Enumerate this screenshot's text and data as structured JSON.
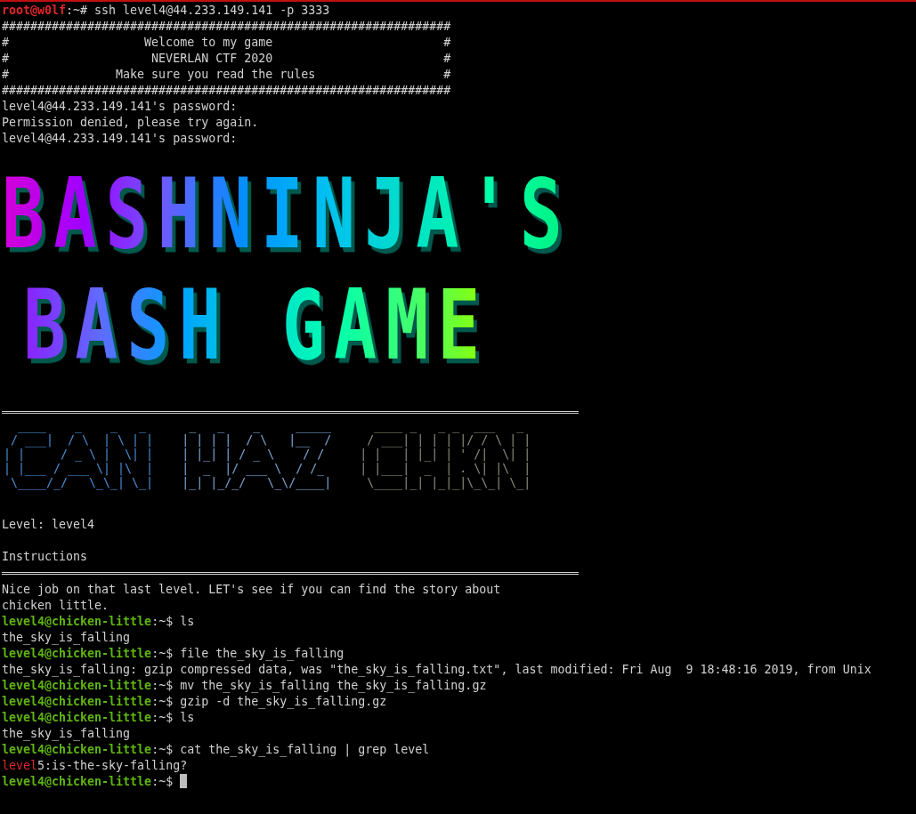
{
  "header_lines": [
    {
      "kind": "prompt",
      "color": "#e3262a",
      "user_host": "root@w0lf",
      "path": ":~#",
      "command": "ssh level4@44.233.149.141 -p 3333",
      "cursor": false
    },
    {
      "kind": "output",
      "text": "###############################################################"
    },
    {
      "kind": "output",
      "text": "#                   Welcome to my game                        #"
    },
    {
      "kind": "output",
      "text": "#                    NEVERLAN CTF 2020                        #"
    },
    {
      "kind": "output",
      "text": "#               Make sure you read the rules                  #"
    },
    {
      "kind": "output",
      "text": "###############################################################"
    },
    {
      "kind": "output",
      "text": "level4@44.233.149.141's password:"
    },
    {
      "kind": "output",
      "text": "Permission denied, please try again."
    },
    {
      "kind": "output",
      "text": "level4@44.233.149.141's password:"
    }
  ],
  "banner": {
    "lines": [
      "BASHNINJA'S",
      "BASH GAME"
    ]
  },
  "ascii_art": {
    "words": [
      {
        "color": "#4a8fd6",
        "lines": [
          "  ____    _    _   _ ",
          " / ___|  / \\  | \\ | |",
          "| |     / _ \\ |  \\| |",
          "| |___ / ___ \\| |\\  |",
          " \\____/_/   \\_\\_| \\_|"
        ]
      },
      {
        "color": "#7ea6d6",
        "lines": [
          " _   _    _     _____",
          "| | | |  / \\   |__  /",
          "| |_| | / _ \\    / / ",
          "|  _  |/ ___ \\  / /_ ",
          "|_| |_/_/   \\_\\/____|"
        ]
      },
      {
        "color": "#8c8c7a",
        "lines": [
          "  ____ _   _ _  ___   _ ",
          " / ___| | | | |/ / \\ | |",
          "| |   | |_| | ' /|  \\| |",
          "| |___|  _  | . \\| |\\  |",
          " \\____|_| |_|_|\\_\\_| \\_|"
        ]
      }
    ]
  },
  "info_lines": [
    "Level: level4",
    "Instructions"
  ],
  "session_lines": [
    {
      "kind": "output",
      "text": "Nice job on that last level. LET's see if you can find the story about"
    },
    {
      "kind": "output",
      "text": "chicken little."
    },
    {
      "kind": "prompt",
      "color": "#5fb40f",
      "user_host": "level4@chicken-little",
      "path": ":~$",
      "command": "ls",
      "cursor": false
    },
    {
      "kind": "output",
      "text": "the_sky_is_falling"
    },
    {
      "kind": "prompt",
      "color": "#5fb40f",
      "user_host": "level4@chicken-little",
      "path": ":~$",
      "command": "file the_sky_is_falling",
      "cursor": false
    },
    {
      "kind": "output",
      "text": "the_sky_is_falling: gzip compressed data, was \"the_sky_is_falling.txt\", last modified: Fri Aug  9 18:48:16 2019, from Unix"
    },
    {
      "kind": "prompt",
      "color": "#5fb40f",
      "user_host": "level4@chicken-little",
      "path": ":~$",
      "command": "mv the_sky_is_falling the_sky_is_falling.gz",
      "cursor": false
    },
    {
      "kind": "prompt",
      "color": "#5fb40f",
      "user_host": "level4@chicken-little",
      "path": ":~$",
      "command": "gzip -d the_sky_is_falling.gz",
      "cursor": false
    },
    {
      "kind": "prompt",
      "color": "#5fb40f",
      "user_host": "level4@chicken-little",
      "path": ":~$",
      "command": "ls",
      "cursor": false
    },
    {
      "kind": "output",
      "text": "the_sky_is_falling"
    },
    {
      "kind": "prompt",
      "color": "#5fb40f",
      "user_host": "level4@chicken-little",
      "path": ":~$",
      "command": "cat the_sky_is_falling | grep level",
      "cursor": false
    },
    {
      "kind": "match",
      "match": "level",
      "rest": "5:is-the-sky-falling?"
    },
    {
      "kind": "prompt",
      "color": "#5fb40f",
      "user_host": "level4@chicken-little",
      "path": ":~$",
      "cursor": true
    }
  ]
}
